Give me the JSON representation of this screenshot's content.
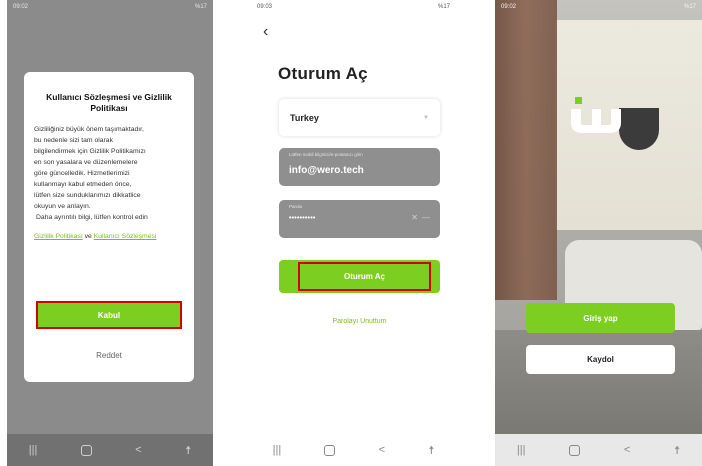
{
  "colors": {
    "accent": "#7ccf20",
    "link": "#7bbf1e",
    "highlight": "#d40000"
  },
  "screen1": {
    "status": {
      "time": "09:02",
      "right": "%17"
    },
    "dialog": {
      "title": "Kullanıcı Sözleşmesi ve Gizlilik Politikası",
      "body_lines": [
        "Gizliliğiniz büyük önem taşımaktadır,",
        "bu nedenle sizi tam olarak",
        "bilgilendirmek için Gizlilik Politikamızı",
        "en son yasalara ve düzenlemelere",
        "göre güncelledik. Hizmetlerimizi",
        "kullanmayı kabul etmeden önce,",
        "lütfen size sunduklarımızı dikkatlice",
        "okuyun ve anlayın."
      ],
      "body_more": "Daha ayrıntılı bilgi, lütfen kontrol edin",
      "link_privacy": "Gizlilik Politikası",
      "link_join": "ve",
      "link_terms": "Kullanıcı Sözleşmesi",
      "accept": "Kabul",
      "reject": "Reddet"
    }
  },
  "screen2": {
    "status": {
      "time": "09:03",
      "right": "%17"
    },
    "title": "Oturum Aç",
    "country": "Turkey",
    "email_placeholder": "Lütfen mobil bilginizi/e-postanızı girin",
    "email_value": "info@wero.tech",
    "password_label": "Parola",
    "password_value": "••••••••••",
    "login_button": "Oturum Aç",
    "forgot": "Parolayı Unuttum"
  },
  "screen3": {
    "status": {
      "time": "09:02",
      "right": "%17"
    },
    "signin": "Giriş yap",
    "register": "Kaydol"
  },
  "icons": {
    "back": "chevron-left-icon",
    "caret": "caret-down-icon",
    "clear": "clear-icon",
    "eye": "eye-icon",
    "nav_recent": "recent-apps-icon",
    "nav_home": "home-icon",
    "nav_back": "back-icon",
    "nav_accessibility": "accessibility-icon",
    "logo": "wero-logo-icon"
  }
}
